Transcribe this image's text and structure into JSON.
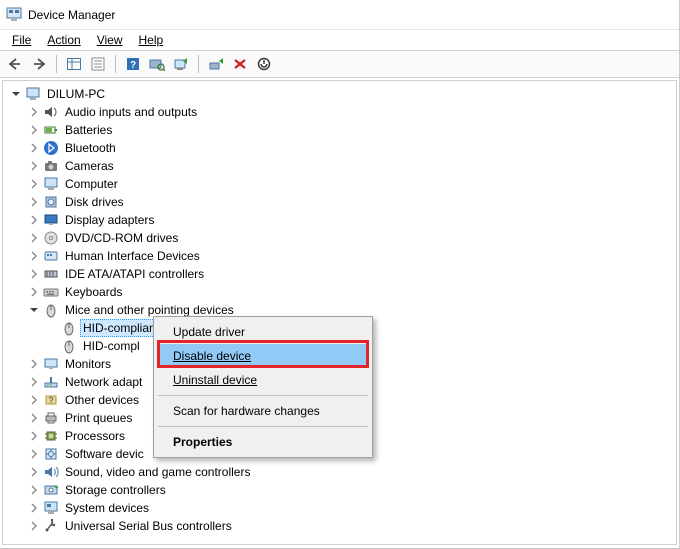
{
  "window": {
    "title": "Device Manager"
  },
  "menubar": {
    "file": "File",
    "action": "Action",
    "view": "View",
    "help": "Help"
  },
  "tree": {
    "root": "DILUM-PC",
    "items": [
      {
        "label": "Audio inputs and outputs",
        "icon": "speaker"
      },
      {
        "label": "Batteries",
        "icon": "battery"
      },
      {
        "label": "Bluetooth",
        "icon": "bluetooth"
      },
      {
        "label": "Cameras",
        "icon": "camera"
      },
      {
        "label": "Computer",
        "icon": "computer"
      },
      {
        "label": "Disk drives",
        "icon": "disk"
      },
      {
        "label": "Display adapters",
        "icon": "display"
      },
      {
        "label": "DVD/CD-ROM drives",
        "icon": "cd"
      },
      {
        "label": "Human Interface Devices",
        "icon": "hid"
      },
      {
        "label": "IDE ATA/ATAPI controllers",
        "icon": "ide"
      },
      {
        "label": "Keyboards",
        "icon": "keyboard"
      },
      {
        "label": "Mice and other pointing devices",
        "icon": "mouse",
        "open": true,
        "children": [
          {
            "label": "HID-compliant mouse",
            "icon": "mouse",
            "selected": true
          },
          {
            "label": "HID-compl",
            "icon": "mouse"
          }
        ]
      },
      {
        "label": "Monitors",
        "icon": "monitor"
      },
      {
        "label": "Network adapt",
        "icon": "network"
      },
      {
        "label": "Other devices",
        "icon": "other"
      },
      {
        "label": "Print queues",
        "icon": "printer"
      },
      {
        "label": "Processors",
        "icon": "processor"
      },
      {
        "label": "Software devic",
        "icon": "software"
      },
      {
        "label": "Sound, video and game controllers",
        "icon": "sound"
      },
      {
        "label": "Storage controllers",
        "icon": "storage"
      },
      {
        "label": "System devices",
        "icon": "system"
      },
      {
        "label": "Universal Serial Bus controllers",
        "icon": "usb"
      }
    ]
  },
  "context_menu": {
    "update": "Update driver",
    "disable": "Disable device",
    "uninstall": "Uninstall device",
    "scan": "Scan for hardware changes",
    "properties": "Properties"
  }
}
